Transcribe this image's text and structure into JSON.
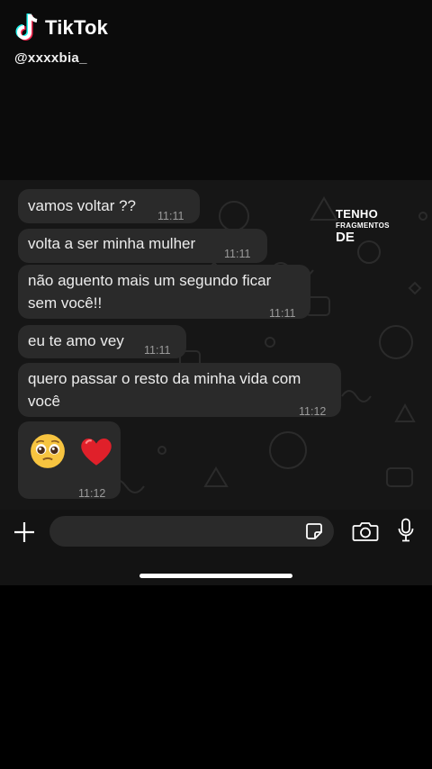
{
  "watermark": {
    "brand": "TikTok",
    "username": "@xxxxbia_"
  },
  "overlay_text": {
    "line1": "TENHO",
    "line2": "FRAGMENTOS",
    "line3": "DE"
  },
  "messages": [
    {
      "text": "vamos voltar ??",
      "time": "11:11"
    },
    {
      "text": "volta a ser minha mulher",
      "time": "11:11"
    },
    {
      "line1": "não aguento mais um segundo ficar",
      "line2": "sem você!!",
      "time": "11:11"
    },
    {
      "text": "eu te amo vey",
      "time": "11:11"
    },
    {
      "line1": "quero passar o resto da minha vida com",
      "line2": "você",
      "time": "11:12"
    },
    {
      "emoji1": "🥹",
      "emoji2": "❤️",
      "time": "11:12"
    }
  ],
  "input_bar": {
    "icons": [
      "plus-icon",
      "sticker-icon",
      "camera-icon",
      "microphone-icon"
    ],
    "message_value": ""
  },
  "colors": {
    "bubble": "#2a2a2a",
    "chat_background": "#161616",
    "time_text": "#9a9a9a"
  }
}
